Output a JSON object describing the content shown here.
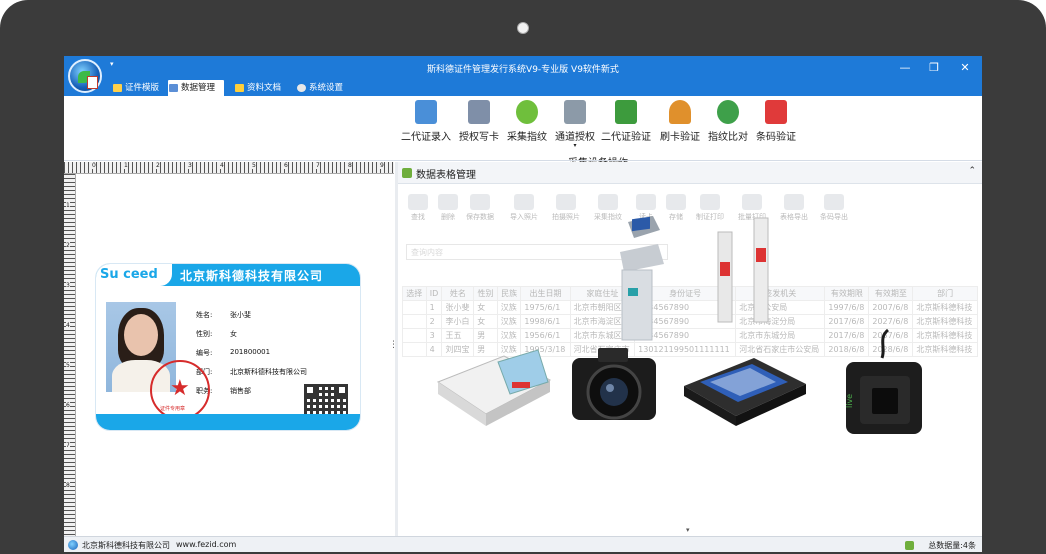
{
  "window": {
    "title": "斯科德证件管理发行系统V9-专业版   V9软件新式",
    "minimize": "—",
    "maximize": "❐",
    "close": "✕"
  },
  "tabs": [
    {
      "label": "证件模版",
      "icon": "template-icon"
    },
    {
      "label": "数据管理",
      "icon": "data-icon"
    },
    {
      "label": "资料文档",
      "icon": "document-icon"
    },
    {
      "label": "系统设置",
      "icon": "settings-icon"
    }
  ],
  "ribbon": {
    "group_label": "采集设备操作",
    "buttons": [
      {
        "label": "二代证录入",
        "icon": "id-card-read-icon",
        "color": "#4a8fd8"
      },
      {
        "label": "授权写卡",
        "icon": "write-card-icon",
        "color": "#7f8fa8"
      },
      {
        "label": "采集指纹",
        "icon": "fingerprint-icon",
        "color": "#6fbf3c"
      },
      {
        "label": "通道授权",
        "icon": "gate-icon",
        "color": "#8c9aa8"
      },
      {
        "label": "二代证验证",
        "icon": "id-card-verify-icon",
        "color": "#3d9b3d"
      },
      {
        "label": "刷卡验证",
        "icon": "person-card-icon",
        "color": "#e0902c"
      },
      {
        "label": "指纹比对",
        "icon": "fingerprint-compare-icon",
        "color": "#3ea04a"
      },
      {
        "label": "条码验证",
        "icon": "barcode-icon",
        "color": "#e03a3a"
      }
    ],
    "dropdown_glyph": "▾",
    "launcher_glyph": "⌟"
  },
  "card": {
    "logo": "Su  ceed",
    "company_title": "北京斯科德科技有限公司",
    "fields": [
      {
        "label": "姓名:",
        "value": "张小斐"
      },
      {
        "label": "性别:",
        "value": "女"
      },
      {
        "label": "编号:",
        "value": "201800001"
      },
      {
        "label": "部门:",
        "value": "北京斯科德科技有限公司"
      },
      {
        "label": "职务:",
        "value": "销售部"
      }
    ],
    "seal_text": "证件专用章"
  },
  "ruler": {
    "h_numbers": [
      "0",
      "1",
      "2",
      "3",
      "4",
      "5",
      "6",
      "7",
      "8",
      "9"
    ],
    "v_numbers": [
      "1",
      "2",
      "3",
      "4",
      "5",
      "6",
      "7",
      "8"
    ]
  },
  "panel": {
    "title": "数据表格管理",
    "collapse": "⌃",
    "toolbar": [
      "查找",
      "删除",
      "保存数据",
      "导入照片",
      "拍摄照片",
      "采集指纹",
      "读卡",
      "存储",
      "制证打印",
      "批量打印",
      "表格导出",
      "条码导出"
    ],
    "search_placeholder": "查询内容",
    "grid_headers": [
      "选择",
      "ID",
      "姓名",
      "性别",
      "民族",
      "出生日期",
      "家庭住址",
      "身份证号",
      "签发机关",
      "有效期限",
      "有效期至",
      "部门"
    ],
    "grid_rows": [
      [
        "",
        "1",
        "张小斐",
        "女",
        "汉族",
        "1975/6/1",
        "北京市朝阳区",
        "1234567890",
        "北京市公安局",
        "1997/6/8",
        "2007/6/8",
        "北京斯科德科技"
      ],
      [
        "",
        "2",
        "李小白",
        "女",
        "汉族",
        "1998/6/1",
        "北京市海淀区",
        "1234567890",
        "北京市海淀分局",
        "2017/6/8",
        "2027/6/8",
        "北京斯科德科技"
      ],
      [
        "",
        "3",
        "王五",
        "男",
        "汉族",
        "1956/6/1",
        "北京市东城区",
        "1234567890",
        "北京市东城分局",
        "2017/6/8",
        "2037/6/8",
        "北京斯科德科技"
      ],
      [
        "",
        "4",
        "刘四宝",
        "男",
        "汉族",
        "1995/3/18",
        "河北省石家庄市",
        "130121199501111111",
        "河北省石家庄市公安局",
        "2018/6/8",
        "2028/6/8",
        "北京斯科德科技"
      ]
    ]
  },
  "status": {
    "company": "北京斯科德科技有限公司",
    "url": "www.fezid.com",
    "total": "总数据量:4条"
  }
}
